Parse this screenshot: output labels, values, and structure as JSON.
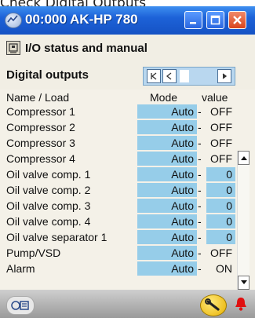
{
  "caption": "Check Digital Outputs",
  "window": {
    "title": "00:000 AK-HP 780",
    "minimize_icon": "minimize-icon",
    "maximize_icon": "maximize-icon",
    "close_icon": "close-icon"
  },
  "section": {
    "title": "I/O status and manual",
    "icon": "io-module-icon"
  },
  "subsection": {
    "title": "Digital outputs"
  },
  "pager": {
    "first_icon": "first-page-icon",
    "prev_icon": "prev-page-icon",
    "next_icon": "next-page-icon"
  },
  "columns": {
    "name": "Name / Load",
    "mode": "Mode",
    "value": "value"
  },
  "rows": [
    {
      "name": "Compressor 1",
      "mode": "Auto",
      "value": "OFF",
      "value_editable": false
    },
    {
      "name": "Compressor 2",
      "mode": "Auto",
      "value": "OFF",
      "value_editable": false
    },
    {
      "name": "Compressor 3",
      "mode": "Auto",
      "value": "OFF",
      "value_editable": false
    },
    {
      "name": "Compressor 4",
      "mode": "Auto",
      "value": "OFF",
      "value_editable": false
    },
    {
      "name": "Oil valve comp. 1",
      "mode": "Auto",
      "value": "0",
      "value_editable": true
    },
    {
      "name": "Oil valve comp. 2",
      "mode": "Auto",
      "value": "0",
      "value_editable": true
    },
    {
      "name": "Oil valve comp. 3",
      "mode": "Auto",
      "value": "0",
      "value_editable": true
    },
    {
      "name": "Oil valve comp. 4",
      "mode": "Auto",
      "value": "0",
      "value_editable": true
    },
    {
      "name": "Oil valve separator 1",
      "mode": "Auto",
      "value": "0",
      "value_editable": true
    },
    {
      "name": "Pump/VSD",
      "mode": "Auto",
      "value": "OFF",
      "value_editable": false
    },
    {
      "name": "Alarm",
      "mode": "Auto",
      "value": "ON",
      "value_editable": false
    }
  ],
  "dash": "-",
  "scrollbar": {
    "up_icon": "scroll-up-icon",
    "down_icon": "scroll-down-icon"
  },
  "footer": {
    "left_icon": "controller-icon",
    "tool_icon": "wrench-icon",
    "alarm_icon": "alarm-bell-icon"
  },
  "colors": {
    "title_bar": "#1d62d8",
    "field": "#96cde9",
    "background": "#f4f1e8",
    "alarm": "#e01010"
  }
}
